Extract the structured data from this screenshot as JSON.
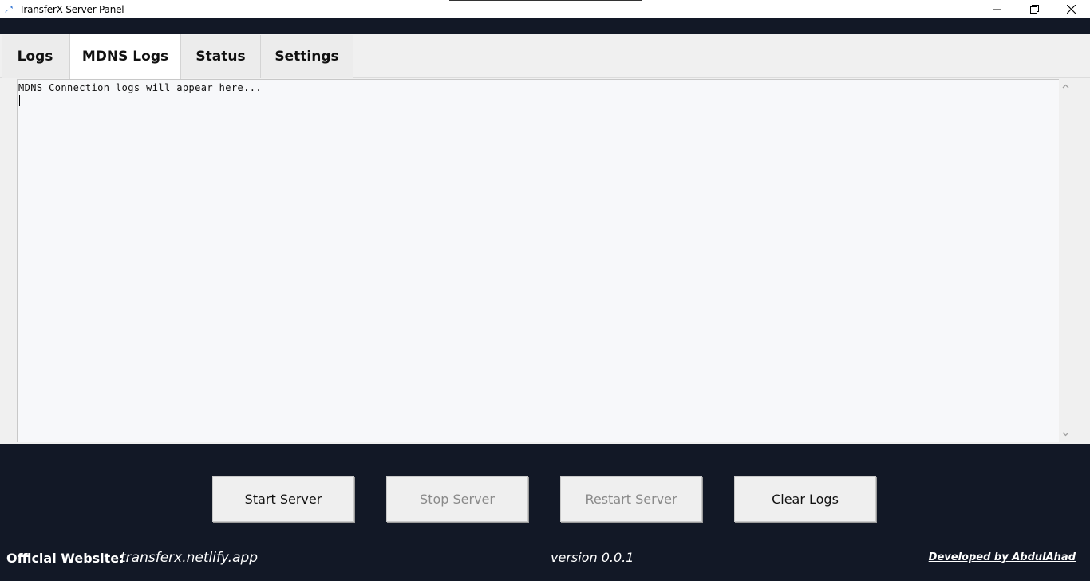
{
  "window": {
    "title": "TransferX Server Panel",
    "app_icon": "transferx-icon",
    "controls": {
      "minimize_icon": "minimize-icon",
      "maximize_icon": "restore-icon",
      "close_icon": "close-icon"
    }
  },
  "tabs": [
    {
      "label": "Logs",
      "active": false
    },
    {
      "label": "MDNS Logs",
      "active": true
    },
    {
      "label": "Status",
      "active": false
    },
    {
      "label": "Settings",
      "active": false
    }
  ],
  "log_area": {
    "text": "MDNS Connection logs will appear here...",
    "scroll_up_icon": "chevron-up-icon",
    "scroll_down_icon": "chevron-down-icon"
  },
  "buttons": {
    "start": {
      "label": "Start Server",
      "enabled": true
    },
    "stop": {
      "label": "Stop Server",
      "enabled": false
    },
    "restart": {
      "label": "Restart Server",
      "enabled": false
    },
    "clear": {
      "label": "Clear Logs",
      "enabled": true
    }
  },
  "footer": {
    "website_label": "Official Website:",
    "website_link": "transferx.netlify.app",
    "version": "version 0.0.1",
    "developer": "Developed by AbdulAhad"
  },
  "colors": {
    "background": "#121826",
    "panel": "#f0f0f0",
    "log_background": "#f7f8fa",
    "button": "#efefef",
    "disabled_text": "#8a8a8a"
  }
}
